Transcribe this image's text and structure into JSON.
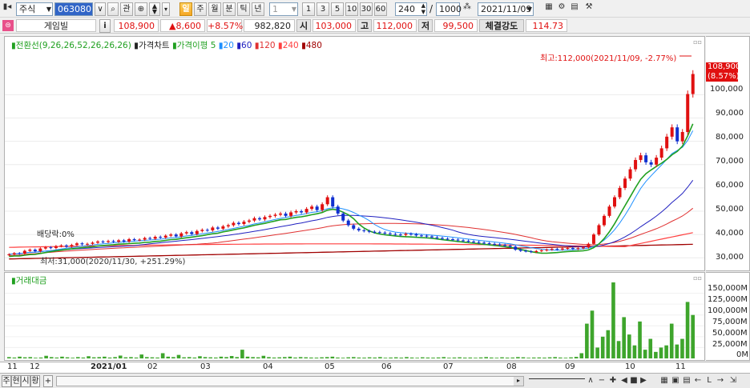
{
  "toolbar": {
    "market": "주식",
    "code": "063080",
    "btn_gwan": "관",
    "periods": [
      "일",
      "주",
      "월",
      "분",
      "틱",
      "년"
    ],
    "interval_value": "1",
    "interval_presets": [
      "1",
      "3",
      "5",
      "10",
      "30",
      "60"
    ],
    "count_value": "240",
    "total_value": "1000",
    "date_value": "2021/11/09"
  },
  "quote": {
    "name": "게임빌",
    "info_label": "i",
    "price": "108,900",
    "change": "▲8,600",
    "change_pct": "+8.57%",
    "volume": "982,820",
    "open_label": "시",
    "open": "103,000",
    "high_label": "고",
    "high": "112,000",
    "low_label": "저",
    "low": "99,500",
    "strength_label": "체결강도",
    "strength": "114.73"
  },
  "chart_data": [
    {
      "type": "candlestick",
      "legend": [
        "전환선(9,26,26,52,26,26,26)",
        "가격차트",
        "가격이평 5",
        "20",
        "60",
        "120",
        "240",
        "480"
      ],
      "legend_colors": [
        "#20a020",
        "#222222",
        "#20a020",
        "#1e90ff",
        "#2020c0",
        "#e03030",
        "#ff4040",
        "#a00000"
      ],
      "annotations": {
        "high": "최고:112,000(2021/11/09, -2.77%)",
        "low": "최저:31,000(2020/11/30, +251.29%)",
        "dividend": "배당락:0%",
        "current_price": "108,900",
        "current_pct": "(8.57%)"
      },
      "yticks": [
        "100,000",
        "90,000",
        "80,000",
        "70,000",
        "60,000",
        "50,000",
        "40,000",
        "30,000"
      ],
      "ylim": [
        27000,
        118000
      ],
      "close": [
        31500,
        32000,
        31800,
        33000,
        33500,
        32800,
        34000,
        34500,
        34200,
        35000,
        35300,
        34800,
        35500,
        36200,
        35800,
        36000,
        36500,
        37000,
        36800,
        37200,
        36900,
        37500,
        37000,
        38000,
        37600,
        37800,
        38500,
        38200,
        39000,
        38700,
        39500,
        40000,
        39200,
        40500,
        41000,
        40200,
        41500,
        42000,
        41800,
        43000,
        42500,
        43500,
        44000,
        45000,
        44500,
        45500,
        46000,
        47000,
        46500,
        47500,
        48000,
        48500,
        49000,
        48000,
        49500,
        50000,
        49500,
        51000,
        52000,
        50500,
        53000,
        56000,
        52000,
        49000,
        46000,
        44000,
        42500,
        41800,
        41500,
        41200,
        41000,
        40800,
        40500,
        40200,
        40000,
        39800,
        40300,
        40100,
        39600,
        39500,
        39200,
        38800,
        38500,
        38200,
        38000,
        37800,
        37500,
        37300,
        37000,
        36800,
        36500,
        36300,
        36000,
        35800,
        35500,
        35200,
        34800,
        33500,
        33000,
        32800,
        32500,
        32900,
        33200,
        33500,
        33800,
        33600,
        34000,
        34200,
        33800,
        34100,
        34500,
        36000,
        40000,
        44000,
        48000,
        52000,
        56000,
        60000,
        64000,
        68000,
        72000,
        74000,
        71000,
        70000,
        73000,
        77000,
        82000,
        86000,
        80000,
        84000,
        100300,
        108900
      ],
      "series": [
        {
          "name": "가격이평 5"
        },
        {
          "name": "20"
        },
        {
          "name": "60"
        },
        {
          "name": "120"
        },
        {
          "name": "240"
        },
        {
          "name": "480"
        }
      ]
    },
    {
      "type": "bar",
      "legend": [
        "거래대금"
      ],
      "yticks": [
        "150,000M",
        "125,000M",
        "100,000M",
        "75,000M",
        "50,000M",
        "25,000M",
        "0M"
      ],
      "ylim": [
        0,
        175000
      ],
      "values": [
        3000,
        2000,
        4000,
        2500,
        3000,
        1500,
        2000,
        6000,
        3000,
        2000,
        4000,
        2500,
        1500,
        3000,
        2000,
        5000,
        2500,
        3000,
        4000,
        2000,
        3000,
        6500,
        2500,
        3000,
        2000,
        9000,
        3000,
        2500,
        2000,
        12000,
        4000,
        3000,
        8000,
        2500,
        3000,
        2000,
        5000,
        3000,
        2500,
        2000,
        4000,
        3000,
        5500,
        3000,
        20000,
        4000,
        3000,
        2500,
        6000,
        3000,
        2000,
        2500,
        3000,
        4000,
        2000,
        3000,
        2500,
        2000,
        1800,
        2500,
        3000,
        4000,
        2000,
        1500,
        2500,
        3000,
        2000,
        1800,
        2500,
        2000,
        3000,
        1500,
        2000,
        2500,
        1800,
        3000,
        2000,
        1500,
        2500,
        2000,
        1800,
        2200,
        3000,
        1500,
        2000,
        2500,
        1800,
        2000,
        1500,
        2200,
        3000,
        2000,
        1500,
        2500,
        1800,
        2000,
        3000,
        2500,
        1500,
        2000,
        2200,
        1800,
        2500,
        3000,
        2000,
        1500,
        2400,
        3500,
        12000,
        80000,
        110000,
        25000,
        50000,
        65000,
        175000,
        40000,
        95000,
        55000,
        30000,
        85000,
        20000,
        45000,
        15000,
        25000,
        30000,
        80000,
        32000,
        45000,
        130000,
        100000
      ]
    }
  ],
  "xaxis": [
    "11",
    "12",
    "2021/01",
    "02",
    "03",
    "04",
    "05",
    "06",
    "07",
    "08",
    "09",
    "10",
    "11"
  ],
  "bottom_tabs": [
    "주",
    "현",
    "시",
    "황",
    "+"
  ]
}
